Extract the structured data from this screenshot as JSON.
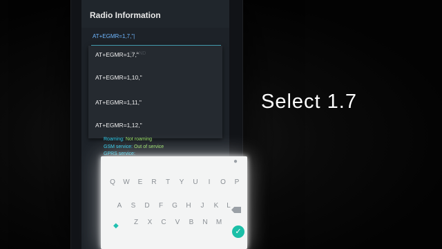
{
  "screen": {
    "title": "Radio Information",
    "input_value": "AT+EGMR=1,7,\"|",
    "ghost_text": "ID AND",
    "dropdown": [
      "AT+EGMR=1,7,\"",
      "AT+EGMR=1,10,\"",
      "AT+EGMR=1,11,\"",
      "AT+EGMR=1,12,\""
    ],
    "status": [
      {
        "key": "Roaming:",
        "value": "Not roaming"
      },
      {
        "key": "GSM service:",
        "value": "Out of service"
      },
      {
        "key": "GPRS service:",
        "value": ""
      }
    ]
  },
  "keyboard": {
    "row1": [
      "Q",
      "W",
      "E",
      "R",
      "T",
      "Y",
      "U",
      "I",
      "O",
      "P"
    ],
    "row2": [
      "A",
      "S",
      "D",
      "F",
      "G",
      "H",
      "J",
      "K",
      "L"
    ],
    "row3": [
      "Z",
      "X",
      "C",
      "V",
      "B",
      "N",
      "M"
    ],
    "mic_icon": "mic-icon",
    "accent_color": "#1bbfa7"
  },
  "caption": "Select 1.7"
}
